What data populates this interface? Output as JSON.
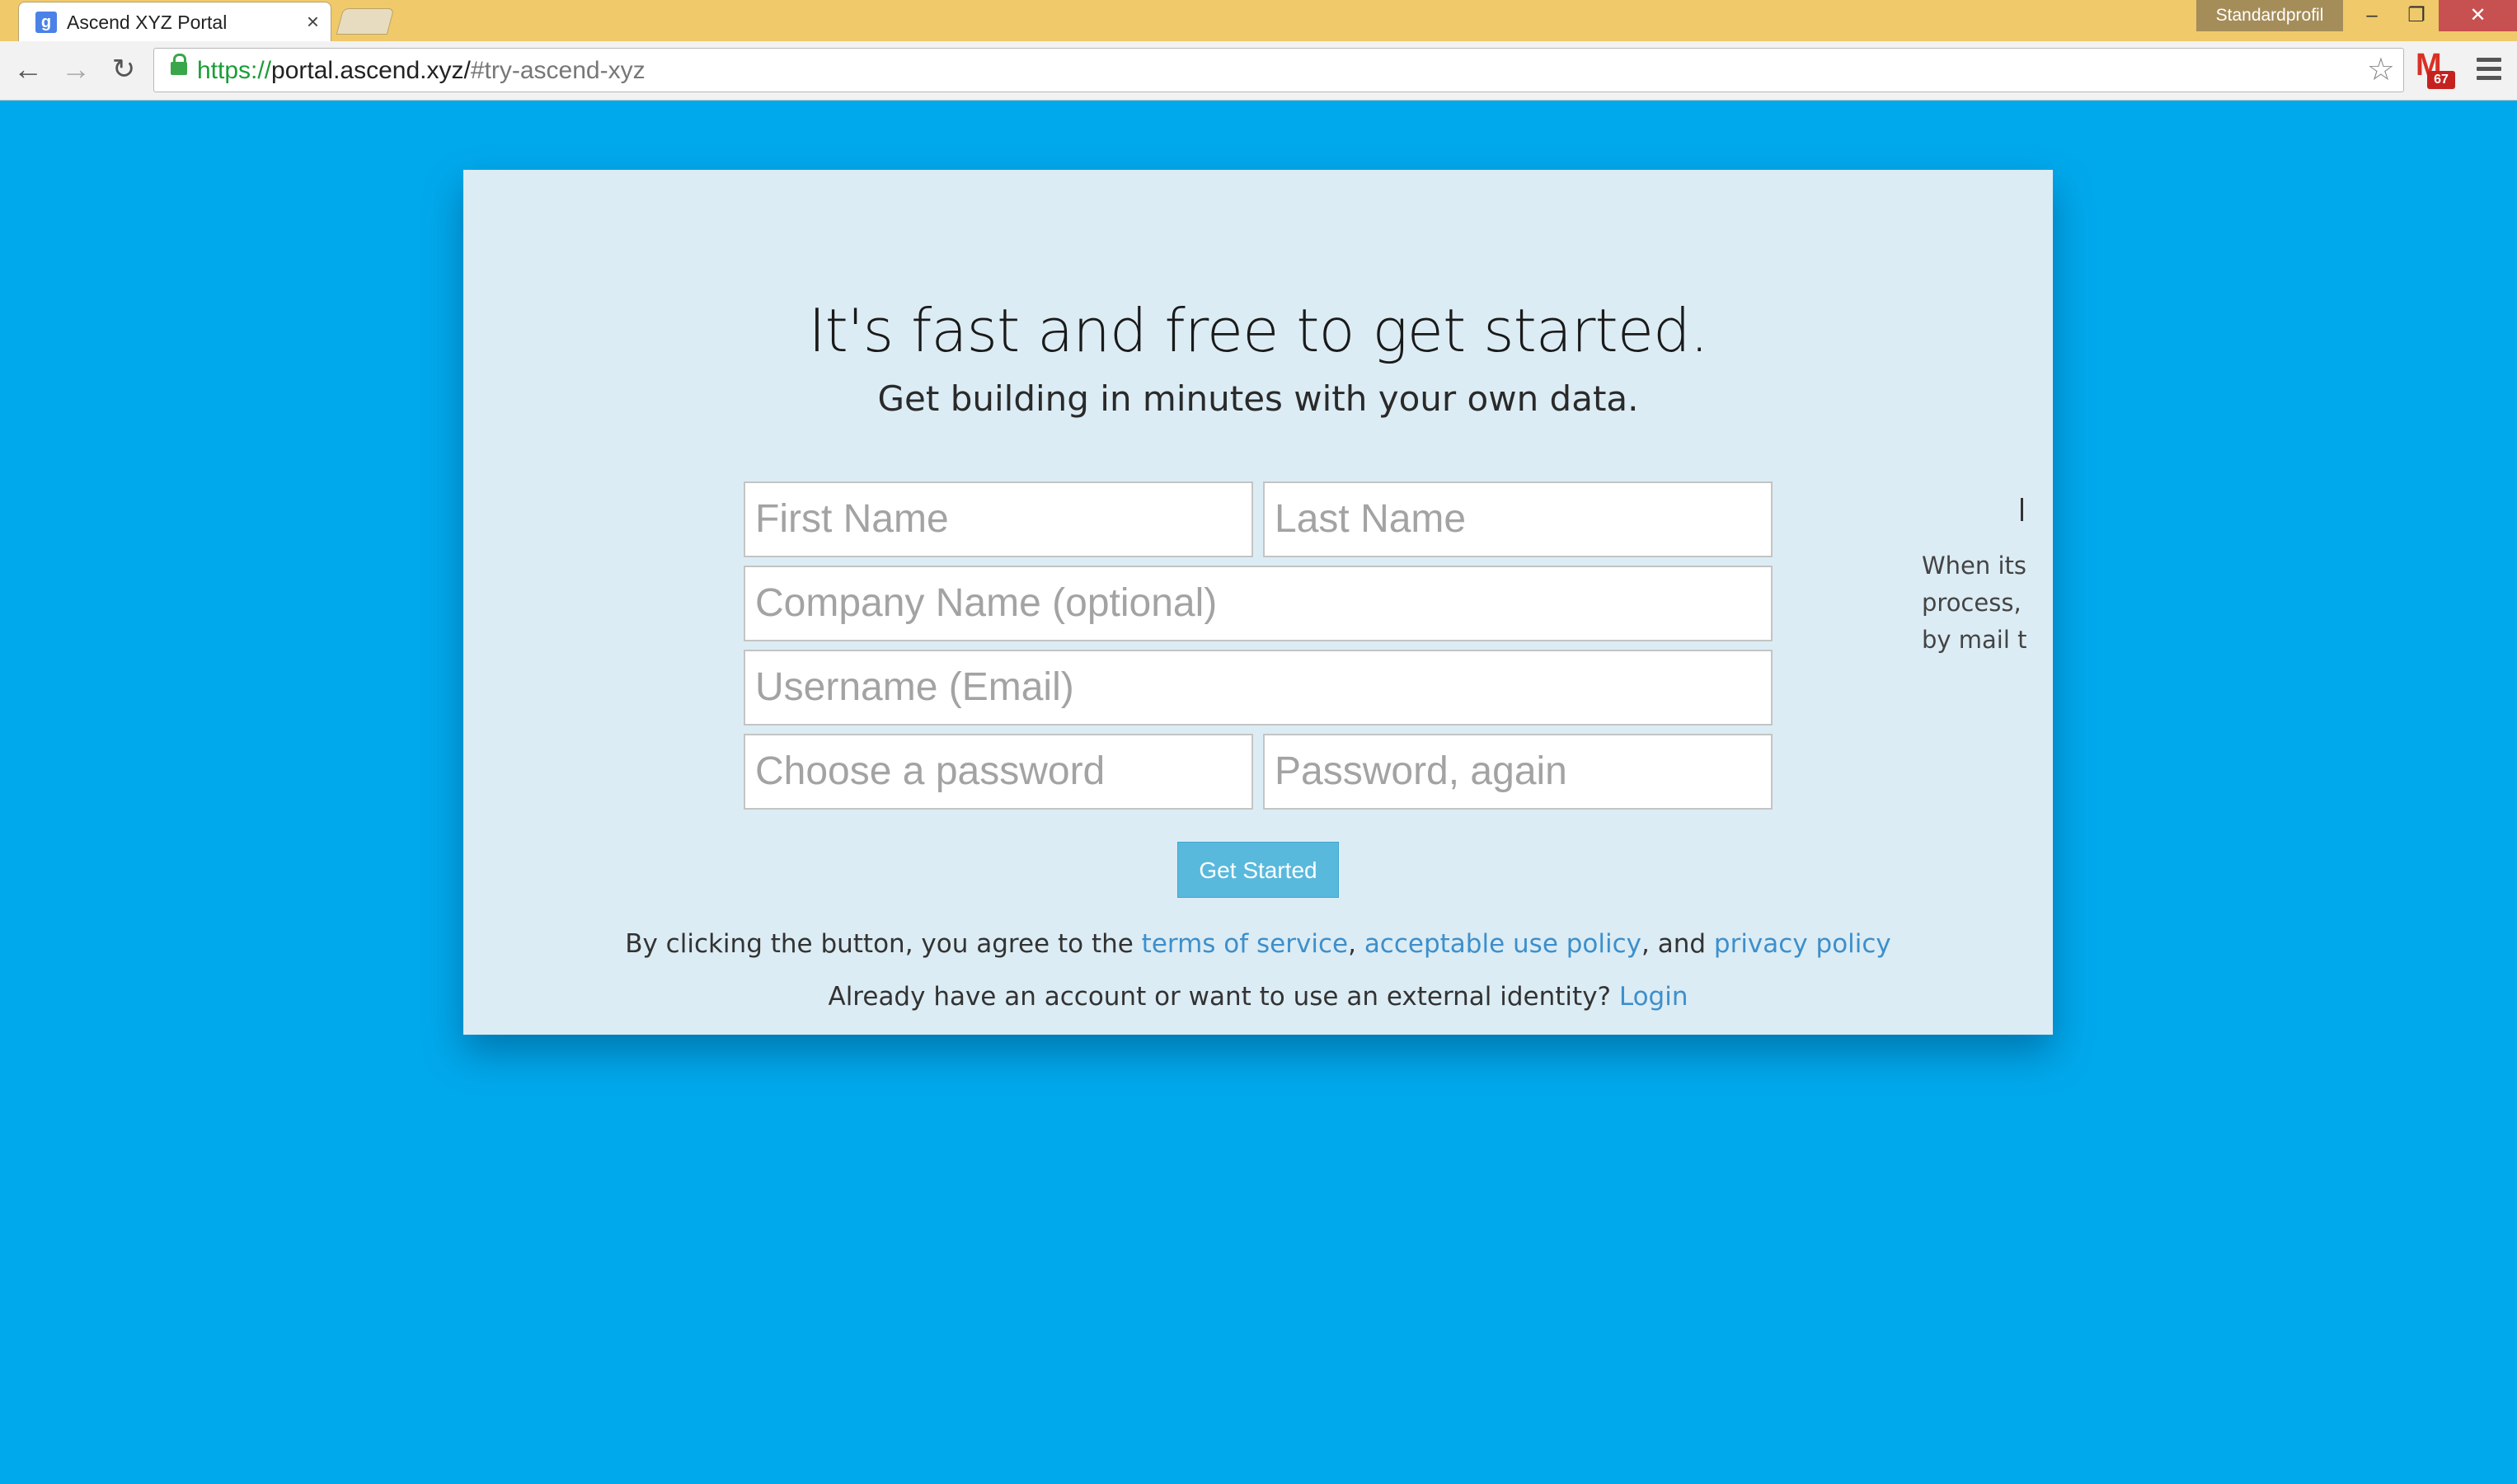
{
  "browser": {
    "tab_title": "Ascend XYZ Portal",
    "tab_favicon": "g",
    "tab_close": "×",
    "profile_label": "Standardprofil",
    "window_controls": {
      "minimize": "–",
      "maximize": "❐",
      "close": "✕"
    },
    "nav": {
      "back": "←",
      "forward": "→",
      "reload": "↻"
    },
    "url": {
      "scheme": "https://",
      "host": "portal.ascend.xyz/",
      "hash": "#try-ascend-xyz"
    },
    "star": "☆",
    "gmail": {
      "letter": "M",
      "badge": "67"
    },
    "colors": {
      "titlebar": "#f0c96a",
      "close_button": "#c75050",
      "secure": "#1a9e36"
    }
  },
  "page": {
    "background": "#00a9ec",
    "headline": "It's fast and free to get started.",
    "subhead": "Get building in minutes with your own data.",
    "form": {
      "first_name_placeholder": "First Name",
      "last_name_placeholder": "Last Name",
      "company_placeholder": "Company Name (optional)",
      "username_placeholder": "Username (Email)",
      "password_placeholder": "Choose a password",
      "password_again_placeholder": "Password, again",
      "submit_label": "Get Started"
    },
    "legal": {
      "prefix": "By clicking the button, you agree to the ",
      "terms": "terms of service",
      "sep1": ", ",
      "aup": "acceptable use policy",
      "sep2": ", and ",
      "privacy": "privacy policy"
    },
    "login": {
      "prefix": "Already have an account or want to use an external identity? ",
      "link": "Login"
    },
    "side_panel_clipped": [
      "When its",
      "process, a",
      "by mail to"
    ],
    "colors": {
      "card": "#dcecf4",
      "button": "#59b9dd",
      "link": "#3d8fcb"
    }
  }
}
